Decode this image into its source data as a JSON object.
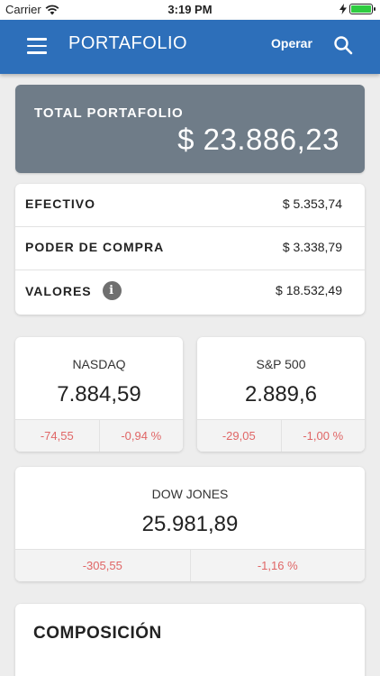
{
  "status_bar": {
    "carrier": "Carrier",
    "time": "3:19 PM"
  },
  "app_bar": {
    "title": "PORTAFOLIO",
    "operar_label": "Operar"
  },
  "total": {
    "label": "TOTAL PORTAFOLIO",
    "value": "$ 23.886,23"
  },
  "balances": [
    {
      "label": "EFECTIVO",
      "value": "$ 5.353,74"
    },
    {
      "label": "PODER DE COMPRA",
      "value": "$ 3.338,79"
    },
    {
      "label": "VALORES",
      "value": "$ 18.532,49",
      "info_icon": "i"
    }
  ],
  "indices": {
    "nasdaq": {
      "name": "NASDAQ",
      "value": "7.884,59",
      "change": "-74,55",
      "change_pct": "-0,94 %"
    },
    "sp500": {
      "name": "S&P 500",
      "value": "2.889,6",
      "change": "-29,05",
      "change_pct": "-1,00 %"
    },
    "dow": {
      "name": "DOW JONES",
      "value": "25.981,89",
      "change": "-305,55",
      "change_pct": "-1,16 %"
    }
  },
  "composition": {
    "title": "COMPOSICIÓN"
  },
  "colors": {
    "app_bar": "#2d6fba",
    "total_card": "#6f7c88",
    "negative": "#e06666"
  },
  "icons": {
    "menu": "hamburger-menu-icon",
    "search": "search-icon",
    "wifi": "wifi-icon",
    "battery": "battery-icon",
    "info": "info-icon"
  }
}
